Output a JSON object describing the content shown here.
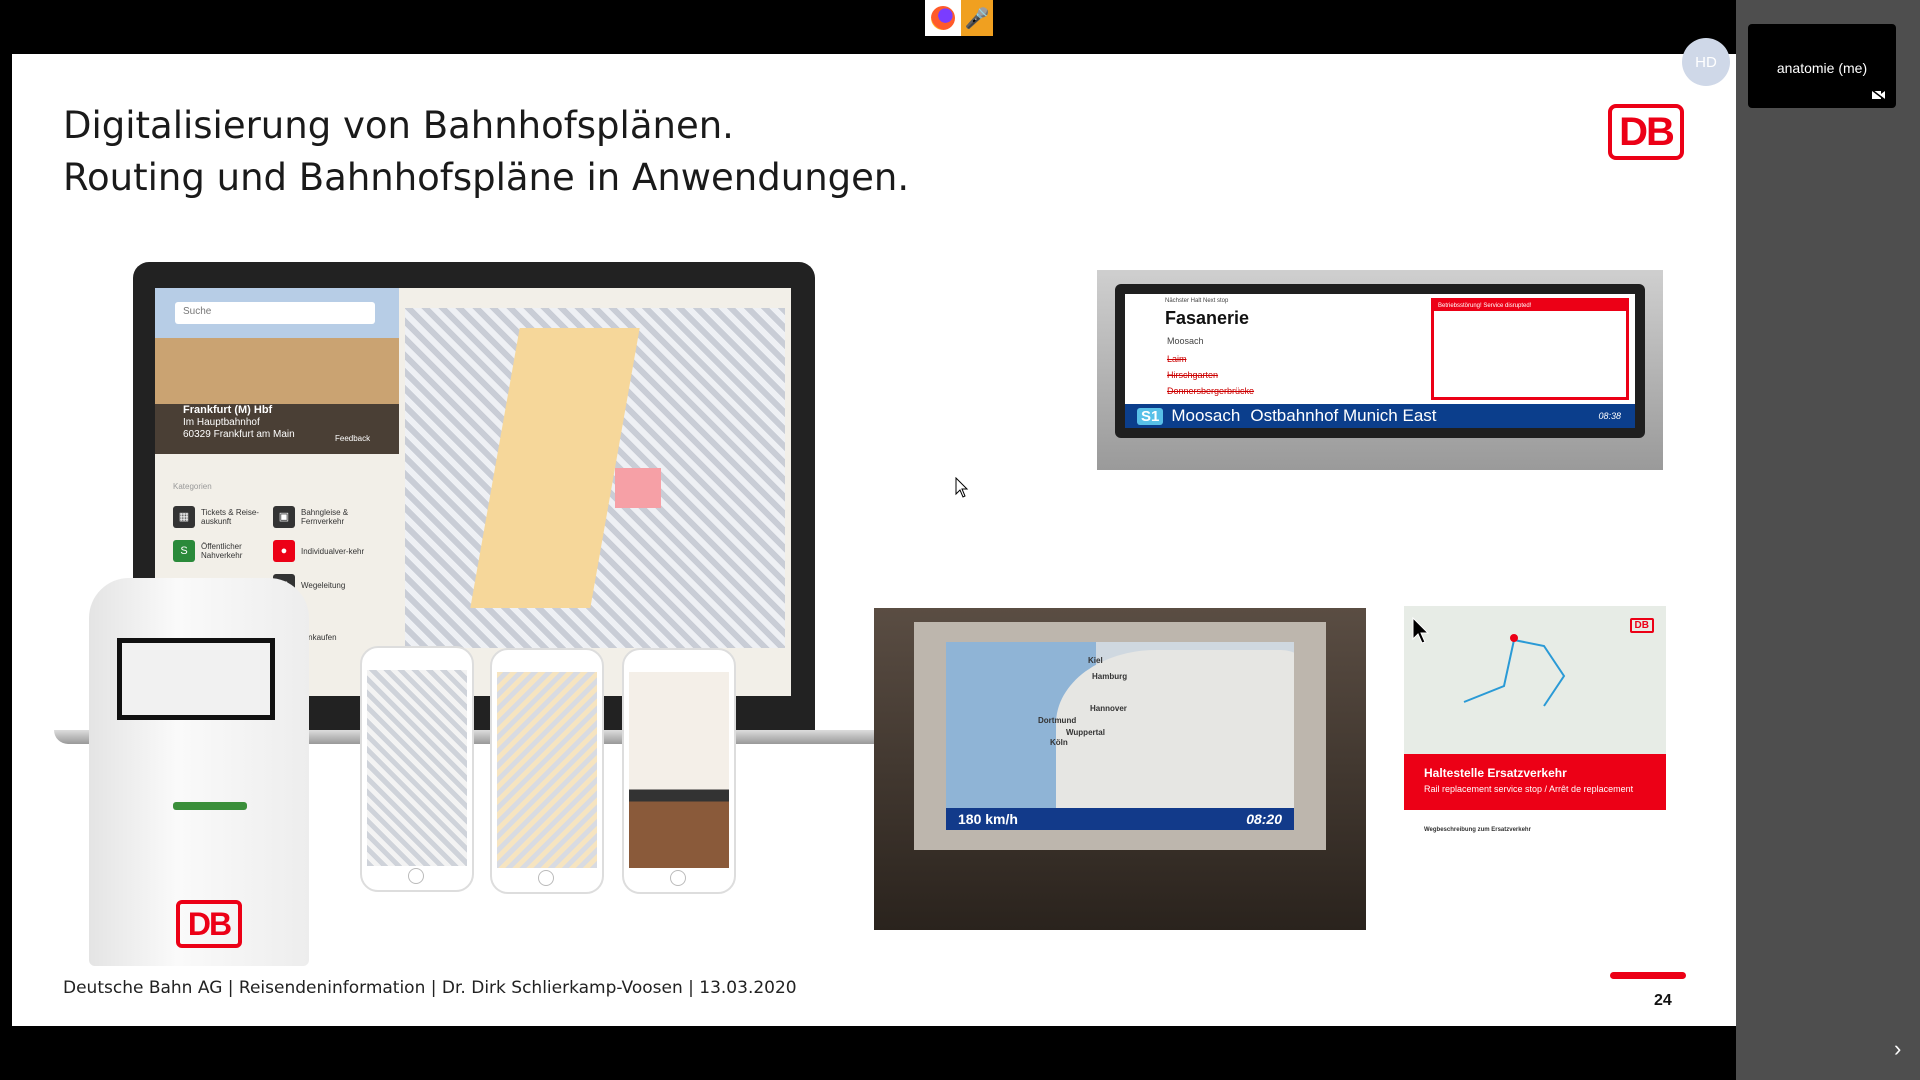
{
  "slide": {
    "title_line1": "Digitalisierung von Bahnhofsplänen.",
    "title_line2": "Routing und Bahnhofspläne in Anwendungen.",
    "logo": "DB",
    "footer": "Deutsche Bahn AG | Reisendeninformation | Dr. Dirk Schlierkamp-Voosen | 13.03.2020",
    "page_number": "24"
  },
  "laptop_app": {
    "search_placeholder": "Suche",
    "station_name": "Frankfurt (M) Hbf",
    "address_line1": "Im Hauptbahnhof",
    "address_line2": "60329 Frankfurt am Main",
    "feedback": "Feedback",
    "categories_label": "Kategorien",
    "categories": [
      "Tickets & Reise-auskunft",
      "Bahngleise & Fernverkehr",
      "Öffentlicher Nahverkehr",
      "Individualver-kehr",
      "Wegeleitung",
      "Einkaufen"
    ]
  },
  "train_display": {
    "next_stop_label": "Nächster Halt Next stop",
    "next_stop": "Fasanerie",
    "stops": [
      "Moosach",
      "Laim",
      "Hirschgarten",
      "Donnersbergerbrücke"
    ],
    "disruption_title": "Betriebsstörung! Service disrupted!",
    "line": "S1",
    "destination": "Moosach",
    "bar_destination": "Ostbahnhof Munich East",
    "time": "08:38"
  },
  "map_display": {
    "speed": "180 km/h",
    "time": "08:20",
    "cities": [
      "Kiel",
      "Hamburg",
      "Hannover",
      "Dortmund",
      "Wuppertal",
      "Köln"
    ]
  },
  "poster": {
    "heading": "Haltestelle Ersatzverkehr",
    "subheading": "Rail replacement service stop / Arrêt de replacement",
    "section": "Wegbeschreibung zum Ersatzverkehr",
    "logo": "DB"
  },
  "kiosk": {
    "logo": "DB"
  },
  "conference": {
    "participant_name": "anatomie (me)",
    "avatar_initials": "HD"
  },
  "colors": {
    "db_red": "#ec0016",
    "train_blue": "#0b3e8c",
    "mic_orange": "#f0a020"
  },
  "icons": [
    "firefox-icon",
    "microphone-icon",
    "camera-off-icon",
    "chevron-right-icon",
    "mouse-cursor-icon"
  ]
}
